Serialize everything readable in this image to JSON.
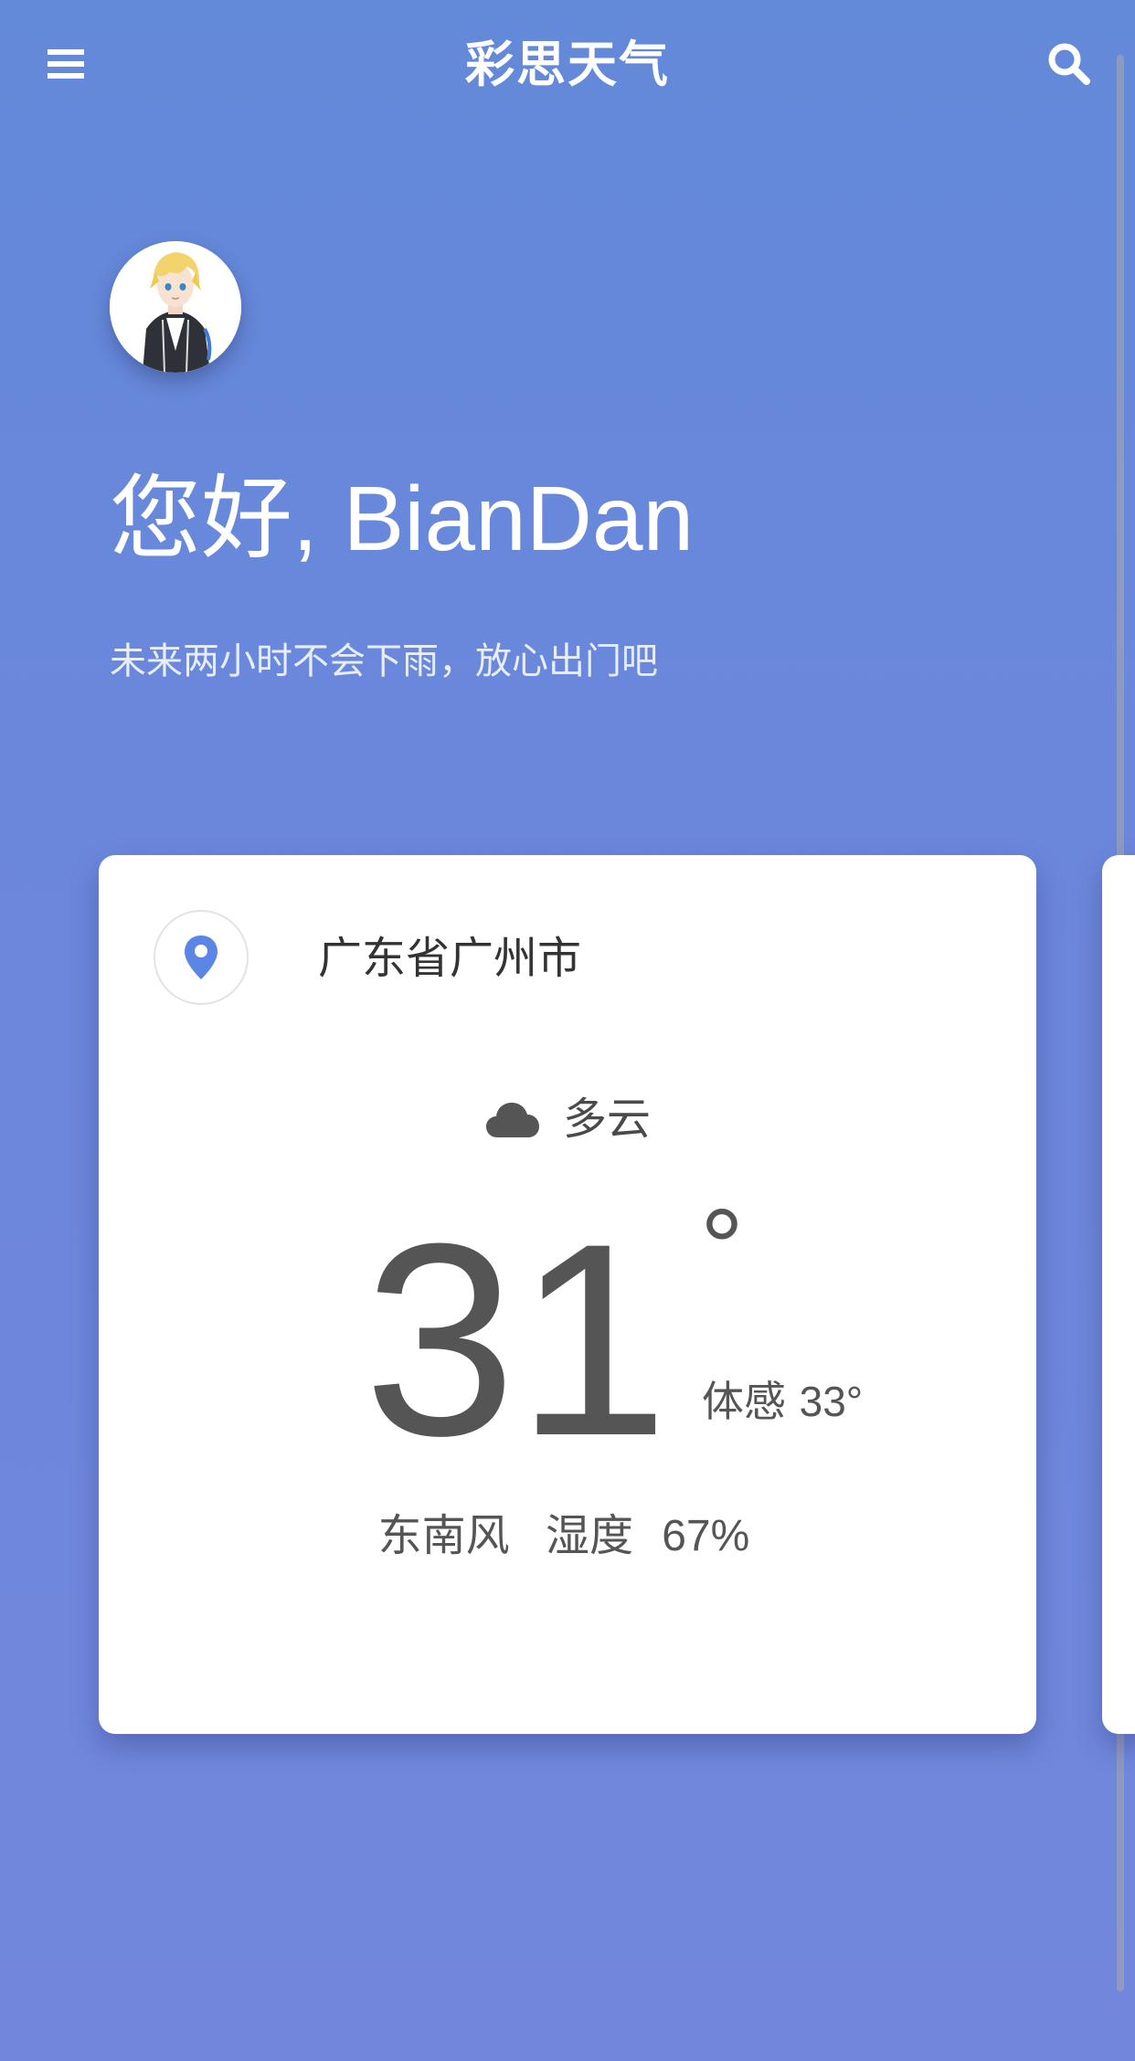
{
  "header": {
    "title": "彩思天气",
    "menu_icon": "hamburger-menu-icon",
    "search_icon": "search-icon"
  },
  "user": {
    "greeting": "您好, BianDan",
    "tip": "未来两小时不会下雨，放心出门吧"
  },
  "weather": {
    "location": "广东省广州市",
    "location_icon": "location-pin-icon",
    "condition_icon": "cloud-icon",
    "condition": "多云",
    "temperature": "31",
    "degree_symbol": "°",
    "feels_like_label": "体感",
    "feels_like_value": "33°",
    "wind": "东南风",
    "humidity_label": "湿度",
    "humidity_value": "67%"
  },
  "colors": {
    "background_top": "#6389d9",
    "background_bottom": "#7287dc",
    "accent": "#5b86e5",
    "card": "#ffffff",
    "text_dark": "#555555"
  }
}
